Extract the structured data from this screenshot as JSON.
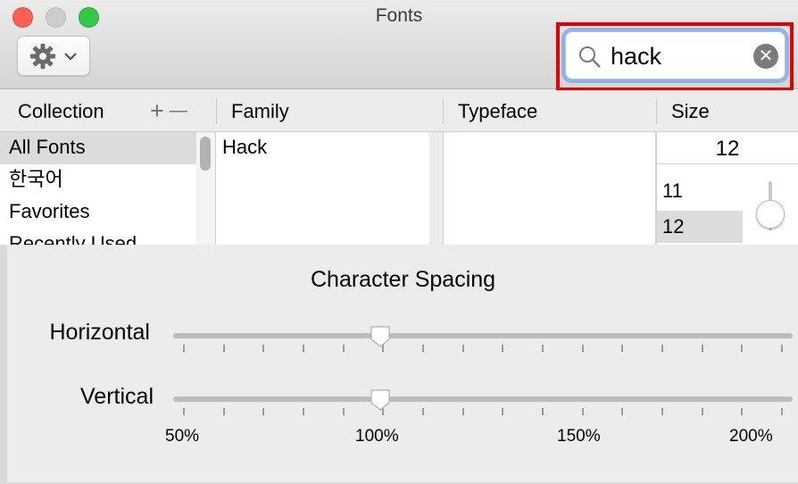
{
  "window": {
    "title": "Fonts"
  },
  "toolbar": {
    "action_icon": "gear-icon",
    "action_chevron": "chevron-down-icon"
  },
  "search": {
    "value": "hack",
    "placeholder": "",
    "clear_icon": "clear-icon",
    "highlight_color": "#e60000"
  },
  "columns": {
    "collection": "Collection",
    "add": "+",
    "remove": "—",
    "family": "Family",
    "typeface": "Typeface",
    "size": "Size"
  },
  "collections": {
    "items": [
      "All Fonts",
      "한국어",
      "Favorites",
      "Recently Used"
    ],
    "selected": "All Fonts"
  },
  "families": {
    "items": [
      "Hack"
    ]
  },
  "typefaces": {
    "items": []
  },
  "size": {
    "value": "12",
    "items": [
      "11",
      "12"
    ],
    "selected": "12"
  },
  "character_spacing": {
    "title": "Character Spacing",
    "horizontal_label": "Horizontal",
    "vertical_label": "Vertical",
    "horizontal_value_pct": 100,
    "vertical_value_pct": 100,
    "scale_labels": [
      "50%",
      "100%",
      "150%",
      "200%"
    ]
  }
}
